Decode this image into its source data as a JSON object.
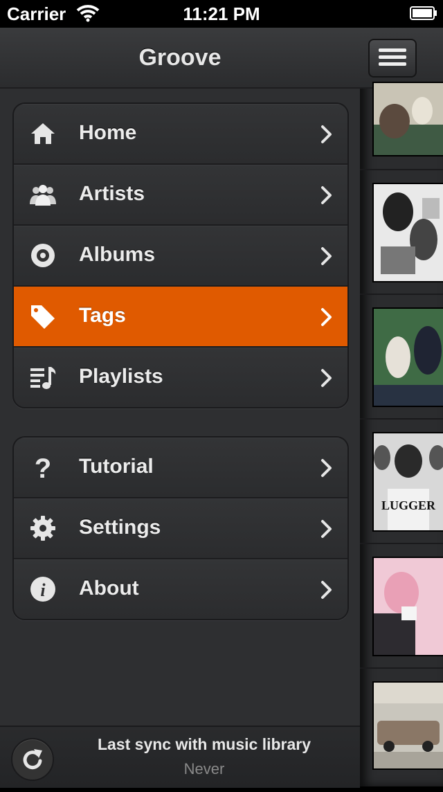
{
  "status_bar": {
    "carrier": "Carrier",
    "time": "11:21 PM"
  },
  "menu": {
    "title": "Groove",
    "groups": [
      {
        "items": [
          {
            "label": "Home",
            "icon": "home-icon"
          },
          {
            "label": "Artists",
            "icon": "artists-icon"
          },
          {
            "label": "Albums",
            "icon": "albums-icon"
          },
          {
            "label": "Tags",
            "icon": "tag-icon",
            "active": true
          },
          {
            "label": "Playlists",
            "icon": "playlist-icon"
          }
        ]
      },
      {
        "items": [
          {
            "label": "Tutorial",
            "icon": "question-icon"
          },
          {
            "label": "Settings",
            "icon": "gear-icon"
          },
          {
            "label": "About",
            "icon": "info-icon"
          }
        ]
      }
    ]
  },
  "footer": {
    "sync_label": "Last sync with music library",
    "sync_value": "Never"
  },
  "colors": {
    "accent": "#e05a00",
    "menu_bg": "#2e2f31",
    "text": "#ececec"
  },
  "right_panel": {
    "thumbnails": 6
  }
}
